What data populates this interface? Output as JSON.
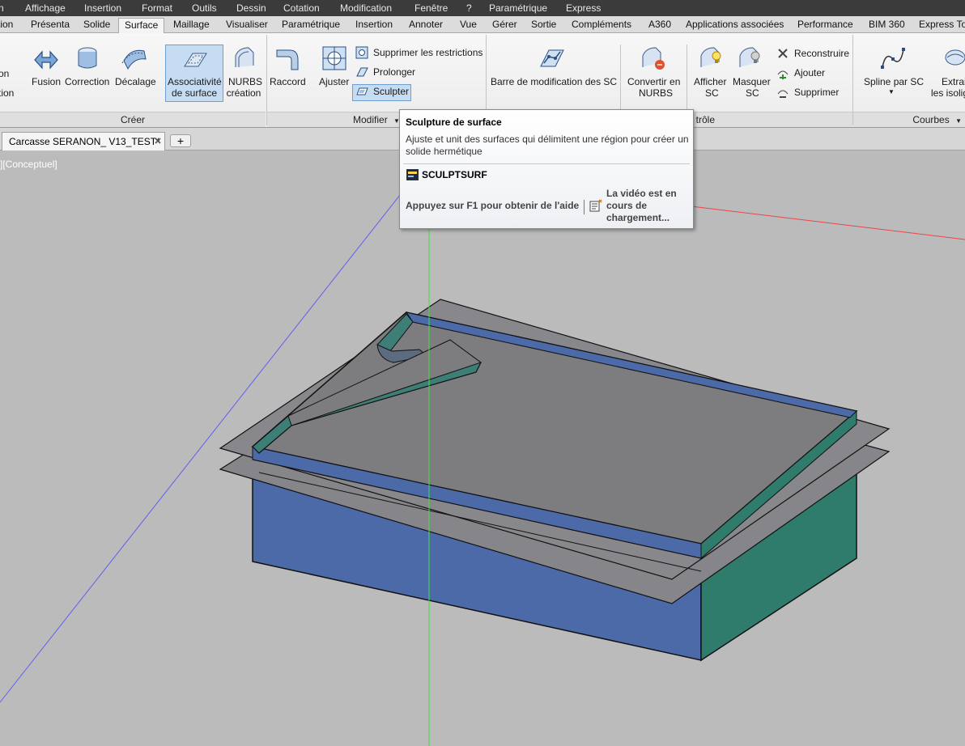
{
  "menubar": {
    "items": [
      "n",
      "Affichage",
      "Insertion",
      "Format",
      "Outils",
      "Dessin",
      "Cotation",
      "Modification",
      "Fenêtre",
      "?",
      "Paramétrique",
      "Express"
    ]
  },
  "ribbon_tabs": {
    "items": [
      "tion",
      "Présenta",
      "Solide",
      "Surface",
      "Maillage",
      "Visualiser",
      "Paramétrique",
      "Insertion",
      "Annoter",
      "Vue",
      "Gérer",
      "Sortie",
      "Compléments",
      "A360",
      "Applications associées",
      "Performance",
      "BIM 360",
      "Express Too"
    ],
    "active": "Surface"
  },
  "ribbon": {
    "creer": {
      "cut_label_1": "on",
      "cut_label_2": "tion",
      "fusion": "Fusion",
      "correction": "Correction",
      "decalage": "Décalage",
      "associativite_1": "Associativité",
      "associativite_2": "de surface",
      "nurbs_1": "NURBS",
      "nurbs_2": "création",
      "title": "Créer"
    },
    "modifier": {
      "raccord": "Raccord",
      "ajuster": "Ajuster",
      "supprimer_restrictions": "Supprimer les restrictions",
      "prolonger": "Prolonger",
      "sculpter": "Sculpter",
      "title": "Modifier"
    },
    "controle": {
      "barre_modif": "Barre de modification des SC",
      "convertir_1": "Convertir en",
      "convertir_2": "NURBS",
      "afficher_1": "Afficher",
      "afficher_2": "SC",
      "masquer_1": "Masquer",
      "masquer_2": "SC",
      "reconstruire": "Reconstruire",
      "ajouter": "Ajouter",
      "supprimer": "Supprimer",
      "title": "trôle"
    },
    "courbes": {
      "spline_sc": "Spline par SC",
      "extrait_1": "Extrai",
      "extrait_2": "les isolig",
      "title": "Courbes"
    }
  },
  "doc_tabs": {
    "active_tab": "Carcasse SERANON_ V13_TEST*",
    "new_tab": "+"
  },
  "viewport": {
    "view_label": "][Conceptuel]"
  },
  "tooltip": {
    "title": "Sculpture de surface",
    "description": "Ajuste et unit des surfaces qui délimitent une région pour créer un solide hermétique",
    "command": "SCULPTSURF",
    "help": "Appuyez sur F1 pour obtenir de l'aide",
    "video": "La vidéo est en cours de chargement..."
  },
  "colors": {
    "menubar_bg": "#3b3b3b",
    "viewport_bg": "#bbbbbb",
    "face_blue": "#4d6aa8",
    "face_teal": "#2f7c6c",
    "face_gray": "#7d7d80",
    "highlight": "#c5dcf3"
  }
}
